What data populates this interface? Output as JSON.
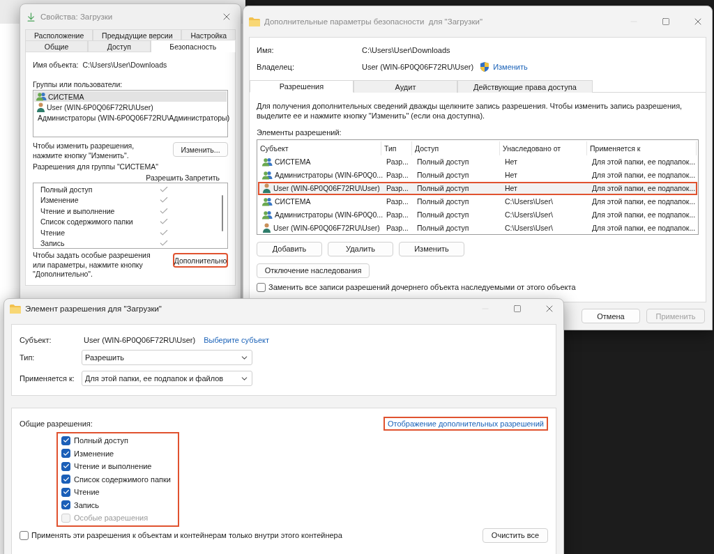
{
  "properties": {
    "title": "Свойства: Загрузки",
    "tab_rows": [
      [
        {
          "label": "Расположение",
          "selected": false
        },
        {
          "label": "Предыдущие версии",
          "selected": false
        },
        {
          "label": "Настройка",
          "selected": false
        }
      ],
      [
        {
          "label": "Общие",
          "selected": false
        },
        {
          "label": "Доступ",
          "selected": false
        },
        {
          "label": "Безопасность",
          "selected": true
        }
      ]
    ],
    "object_name_label": "Имя объекта:",
    "object_name": "C:\\Users\\User\\Downloads",
    "groups_label": "Группы или пользователи:",
    "groups": [
      {
        "name": "СИСТЕМА",
        "kind": "group",
        "selected": true
      },
      {
        "name": "User (WIN-6P0Q06F72RU\\User)",
        "kind": "user",
        "selected": false
      },
      {
        "name": "Администраторы (WIN-6P0Q06F72RU\\Администраторы)",
        "kind": "group",
        "selected": false
      }
    ],
    "change_hint": "Чтобы изменить разрешения, нажмите кнопку \"Изменить\".",
    "change_button": "Изменить...",
    "permissions_label": "Разрешения для группы \"СИСТЕМА\"",
    "allow_header": "Разрешить",
    "deny_header": "Запретить",
    "permissions": [
      {
        "name": "Полный доступ",
        "allow": true
      },
      {
        "name": "Изменение",
        "allow": true
      },
      {
        "name": "Чтение и выполнение",
        "allow": true
      },
      {
        "name": "Список содержимого папки",
        "allow": true
      },
      {
        "name": "Чтение",
        "allow": true
      },
      {
        "name": "Запись",
        "allow": true
      }
    ],
    "advanced_hint": "Чтобы задать особые разрешения или параметры, нажмите кнопку \"Дополнительно\".",
    "advanced_button": {
      "label": "Дополнительно",
      "highlighted": true
    }
  },
  "advanced": {
    "title": "Дополнительные параметры безопасности  для \"Загрузки\"",
    "name_label": "Имя:",
    "name": "C:\\Users\\User\\Downloads",
    "owner_label": "Владелец:",
    "owner": "User (WIN-6P0Q06F72RU\\User)",
    "owner_change_link": "Изменить",
    "tabs": [
      {
        "label": "Разрешения",
        "selected": true
      },
      {
        "label": "Аудит",
        "selected": false
      },
      {
        "label": "Действующие права доступа",
        "selected": false
      }
    ],
    "info": "Для получения дополнительных сведений дважды щелкните запись разрешения. Чтобы изменить запись разрешения, выделите ее и нажмите кнопку \"Изменить\" (если она доступна).",
    "entries_label": "Элементы разрешений:",
    "columns": [
      "Субъект",
      "Тип",
      "Доступ",
      "Унаследовано от",
      "Применяется к"
    ],
    "rows": [
      {
        "kind": "group",
        "highlighted": false,
        "cells": [
          "СИСТЕМА",
          "Разр...",
          "Полный доступ",
          "Нет",
          "Для этой папки, ее подпапок..."
        ]
      },
      {
        "kind": "group",
        "highlighted": false,
        "cells": [
          "Администраторы (WIN-6P0Q0...",
          "Разр...",
          "Полный доступ",
          "Нет",
          "Для этой папки, ее подпапок..."
        ]
      },
      {
        "kind": "user",
        "highlighted": true,
        "cells": [
          "User (WIN-6P0Q06F72RU\\User)",
          "Разр...",
          "Полный доступ",
          "Нет",
          "Для этой папки, ее подпапок..."
        ]
      },
      {
        "kind": "group",
        "highlighted": false,
        "cells": [
          "СИСТЕМА",
          "Разр...",
          "Полный доступ",
          "C:\\Users\\User\\",
          "Для этой папки, ее подпапок..."
        ]
      },
      {
        "kind": "group",
        "highlighted": false,
        "cells": [
          "Администраторы (WIN-6P0Q0...",
          "Разр...",
          "Полный доступ",
          "C:\\Users\\User\\",
          "Для этой папки, ее подпапок..."
        ]
      },
      {
        "kind": "user",
        "highlighted": false,
        "cells": [
          "User (WIN-6P0Q06F72RU\\User)",
          "Разр...",
          "Полный доступ",
          "C:\\Users\\User\\",
          "Для этой папки, ее подпапок..."
        ]
      }
    ],
    "row_buttons": [
      "Добавить",
      "Удалить",
      "Изменить"
    ],
    "inheritance_button": "Отключение наследования",
    "replace_checkbox": {
      "label": "Заменить все записи разрешений дочернего объекта наследуемыми от этого объекта",
      "checked": false
    },
    "buttons": [
      {
        "label": "Отмена",
        "disabled": false
      },
      {
        "label": "Применить",
        "disabled": true
      }
    ]
  },
  "entry": {
    "title": "Элемент разрешения для \"Загрузки\"",
    "subject_label": "Субъект:",
    "subject": "User (WIN-6P0Q06F72RU\\User)",
    "select_subject_link": "Выберите субъект",
    "type_label": "Тип:",
    "type_value": "Разрешить",
    "applies_label": "Применяется к:",
    "applies_value": "Для этой папки, ее подпапок и файлов",
    "general_label": "Общие разрешения:",
    "advanced_link": {
      "label": "Отображение дополнительных разрешений",
      "highlighted": true
    },
    "permissions_highlighted": true,
    "permissions": [
      {
        "label": "Полный доступ",
        "checked": true,
        "disabled": false
      },
      {
        "label": "Изменение",
        "checked": true,
        "disabled": false
      },
      {
        "label": "Чтение и выполнение",
        "checked": true,
        "disabled": false
      },
      {
        "label": "Список содержимого папки",
        "checked": true,
        "disabled": false
      },
      {
        "label": "Чтение",
        "checked": true,
        "disabled": false
      },
      {
        "label": "Запись",
        "checked": true,
        "disabled": false
      },
      {
        "label": "Особые разрешения",
        "checked": false,
        "disabled": true
      }
    ],
    "container_checkbox": {
      "label": "Применять эти разрешения к объектам и контейнерам только внутри этого контейнера",
      "checked": false
    },
    "clear_button": "Очистить все"
  }
}
